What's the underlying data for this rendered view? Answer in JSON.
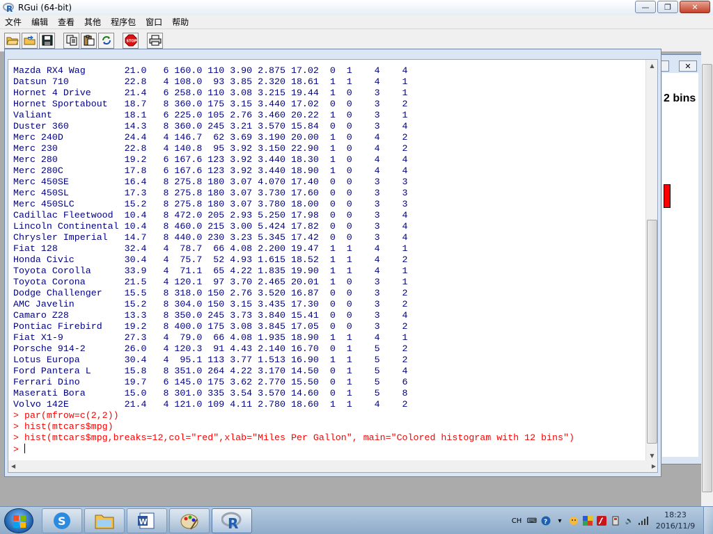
{
  "window": {
    "title": "RGui (64-bit)",
    "controls": {
      "minimize": "—",
      "maximize": "❐",
      "close": "✕"
    }
  },
  "menu": {
    "items": [
      "文件",
      "编辑",
      "查看",
      "其他",
      "程序包",
      "窗口",
      "帮助"
    ]
  },
  "toolbar": {
    "buttons": [
      "open-script-icon",
      "load-workspace-icon",
      "save-workspace-icon",
      "copy-icon",
      "paste-icon",
      "copy-paste-icon",
      "stop-icon",
      "print-icon"
    ]
  },
  "graphics_window": {
    "title_fragment": "2 bins",
    "bar_color": "#ff0000"
  },
  "console": {
    "output_color": "#000080",
    "command_color": "#ff0000",
    "output_lines": [
      "Mazda RX4 Wag       21.0   6 160.0 110 3.90 2.875 17.02  0  1    4    4",
      "Datsun 710          22.8   4 108.0  93 3.85 2.320 18.61  1  1    4    1",
      "Hornet 4 Drive      21.4   6 258.0 110 3.08 3.215 19.44  1  0    3    1",
      "Hornet Sportabout   18.7   8 360.0 175 3.15 3.440 17.02  0  0    3    2",
      "Valiant             18.1   6 225.0 105 2.76 3.460 20.22  1  0    3    1",
      "Duster 360          14.3   8 360.0 245 3.21 3.570 15.84  0  0    3    4",
      "Merc 240D           24.4   4 146.7  62 3.69 3.190 20.00  1  0    4    2",
      "Merc 230            22.8   4 140.8  95 3.92 3.150 22.90  1  0    4    2",
      "Merc 280            19.2   6 167.6 123 3.92 3.440 18.30  1  0    4    4",
      "Merc 280C           17.8   6 167.6 123 3.92 3.440 18.90  1  0    4    4",
      "Merc 450SE          16.4   8 275.8 180 3.07 4.070 17.40  0  0    3    3",
      "Merc 450SL          17.3   8 275.8 180 3.07 3.730 17.60  0  0    3    3",
      "Merc 450SLC         15.2   8 275.8 180 3.07 3.780 18.00  0  0    3    3",
      "Cadillac Fleetwood  10.4   8 472.0 205 2.93 5.250 17.98  0  0    3    4",
      "Lincoln Continental 10.4   8 460.0 215 3.00 5.424 17.82  0  0    3    4",
      "Chrysler Imperial   14.7   8 440.0 230 3.23 5.345 17.42  0  0    3    4",
      "Fiat 128            32.4   4  78.7  66 4.08 2.200 19.47  1  1    4    1",
      "Honda Civic         30.4   4  75.7  52 4.93 1.615 18.52  1  1    4    2",
      "Toyota Corolla      33.9   4  71.1  65 4.22 1.835 19.90  1  1    4    1",
      "Toyota Corona       21.5   4 120.1  97 3.70 2.465 20.01  1  0    3    1",
      "Dodge Challenger    15.5   8 318.0 150 2.76 3.520 16.87  0  0    3    2",
      "AMC Javelin         15.2   8 304.0 150 3.15 3.435 17.30  0  0    3    2",
      "Camaro Z28          13.3   8 350.0 245 3.73 3.840 15.41  0  0    3    4",
      "Pontiac Firebird    19.2   8 400.0 175 3.08 3.845 17.05  0  0    3    2",
      "Fiat X1-9           27.3   4  79.0  66 4.08 1.935 18.90  1  1    4    1",
      "Porsche 914-2       26.0   4 120.3  91 4.43 2.140 16.70  0  1    5    2",
      "Lotus Europa        30.4   4  95.1 113 3.77 1.513 16.90  1  1    5    2",
      "Ford Pantera L      15.8   8 351.0 264 4.22 3.170 14.50  0  1    5    4",
      "Ferrari Dino        19.7   6 145.0 175 3.62 2.770 15.50  0  1    5    6",
      "Maserati Bora       15.0   8 301.0 335 3.54 3.570 14.60  0  1    5    8",
      "Volvo 142E          21.4   4 121.0 109 4.11 2.780 18.60  1  1    4    2"
    ],
    "commands": [
      "> par(mfrow=c(2,2))",
      "> hist(mtcars$mpg)",
      "> hist(mtcars$mpg,breaks=12,col=\"red\",xlab=\"Miles Per Gallon\", main=\"Colored histogram with 12 bins\")"
    ],
    "prompt": "> "
  },
  "taskbar": {
    "pinned": [
      "sogou-icon",
      "explorer-icon",
      "word-icon",
      "paint-icon",
      "r-icon"
    ],
    "tray": {
      "ime": "CH",
      "time": "18:23",
      "date": "2016/11/9"
    }
  }
}
